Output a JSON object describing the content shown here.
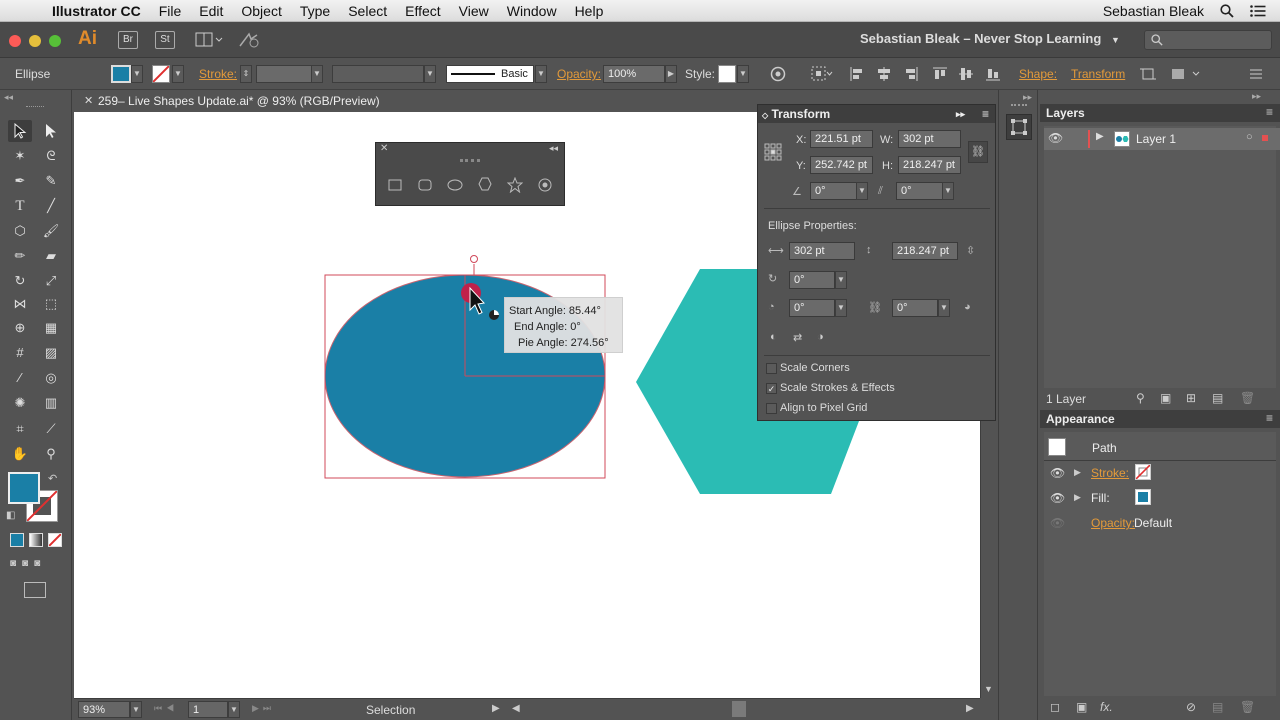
{
  "menubar": {
    "app_name": "Illustrator CC",
    "items": [
      "File",
      "Edit",
      "Object",
      "Type",
      "Select",
      "Effect",
      "View",
      "Window",
      "Help"
    ],
    "user": "Sebastian Bleak"
  },
  "appbar": {
    "logo": "Ai",
    "bridge": "Br",
    "stock": "St",
    "workspace": "Sebastian Bleak – Never Stop Learning"
  },
  "controlbar": {
    "tool_name": "Ellipse",
    "stroke_label": "Stroke:",
    "brush_label": "Basic",
    "opacity_label": "Opacity:",
    "opacity_value": "100%",
    "style_label": "Style:",
    "shape_label": "Shape:",
    "transform_label": "Transform",
    "fill_color": "#1a7fa6"
  },
  "document": {
    "tab_title": "259– Live Shapes Update.ai* @ 93% (RGB/Preview)",
    "zoom": "93%",
    "artboard": "1",
    "status_tool": "Selection"
  },
  "tooltip": {
    "start_angle": "Start Angle: 85.44°",
    "end_angle": "End Angle: 0°",
    "pie_angle": "Pie Angle: 274.56°"
  },
  "transform_panel": {
    "title": "Transform",
    "x_label": "X:",
    "x_value": "221.51 pt",
    "y_label": "Y:",
    "y_value": "252.742 pt",
    "w_label": "W:",
    "w_value": "302 pt",
    "h_label": "H:",
    "h_value": "218.247 pt",
    "rotate_value": "0°",
    "shear_value": "0°",
    "ellipse_props_label": "Ellipse Properties:",
    "ellipse_w": "302 pt",
    "ellipse_h": "218.247 pt",
    "ellipse_rotate": "0°",
    "pie_start": "0°",
    "pie_end": "0°",
    "scale_corners": "Scale Corners",
    "scale_strokes": "Scale Strokes & Effects",
    "align_pixel": "Align to Pixel Grid",
    "scale_corners_checked": false,
    "scale_strokes_checked": true,
    "align_pixel_checked": false
  },
  "layers_panel": {
    "title": "Layers",
    "layer_name": "Layer 1",
    "count": "1 Layer"
  },
  "appearance_panel": {
    "title": "Appearance",
    "object": "Path",
    "stroke_label": "Stroke:",
    "fill_label": "Fill:",
    "opacity_label": "Opacity:",
    "opacity_value": "Default"
  },
  "colors": {
    "ellipse": "#1a7fa6",
    "hexagon": "#2bbcb4",
    "selection": "#d0485a",
    "accent_orange": "#e39a3a"
  }
}
